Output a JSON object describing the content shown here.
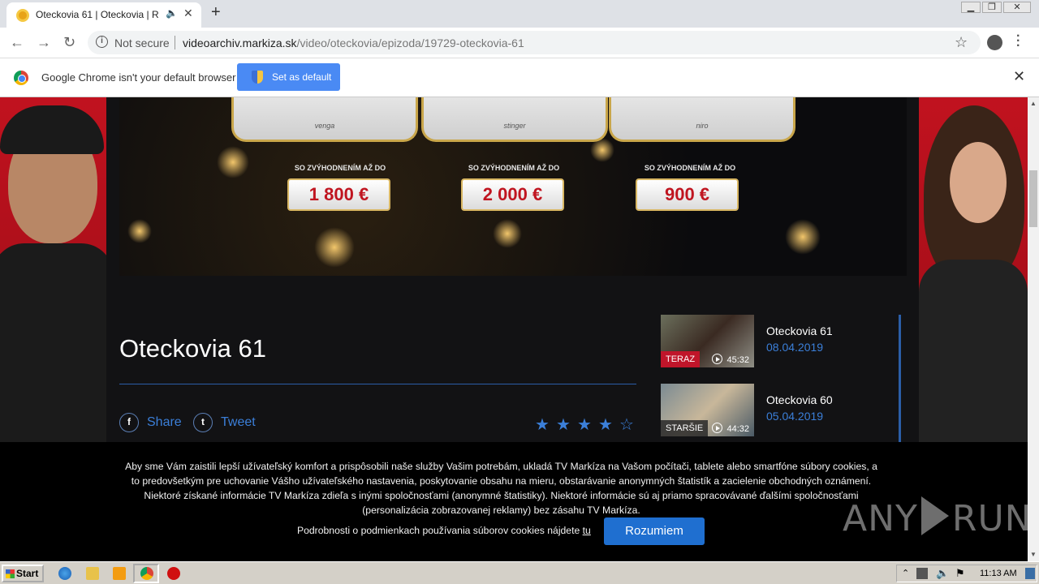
{
  "browser": {
    "tab_title": "Oteckovia 61 | Oteckovia | Relá",
    "url_security": "Not secure",
    "url_domain": "videoarchiv.markiza.sk",
    "url_path": "/video/oteckovia/epizoda/19729-oteckovia-61",
    "infobar_text": "Google Chrome isn't your default browser",
    "set_default_label": "Set as default"
  },
  "ad": {
    "cars": [
      "venga",
      "stinger",
      "niro"
    ],
    "caption": "SO ZVÝHODNENÍM AŽ DO",
    "prices": [
      "1 800 €",
      "2 000 €",
      "900 €"
    ]
  },
  "episode": {
    "title": "Oteckovia 61",
    "share_label": "Share",
    "tweet_label": "Tweet",
    "rating": 4,
    "rating_max": 5
  },
  "playlist": [
    {
      "badge": "TERAZ",
      "duration": "45:32",
      "title": "Oteckovia 61",
      "date": "08.04.2019"
    },
    {
      "badge": "STARŠIE",
      "duration": "44:32",
      "title": "Oteckovia 60",
      "date": "05.04.2019"
    }
  ],
  "cookie": {
    "text": "Aby sme Vám zaistili lepší užívateľský komfort a prispôsobili naše služby Vašim potrebám, ukladá TV Markíza na Vašom počítači, tablete alebo smartfóne súbory cookies, a to predovšetkým pre uchovanie Vášho užívateľského nastavenia, poskytovanie obsahu na mieru, obstarávanie anonymných štatistík a zacielenie obchodných oznámení. Niektoré získané informácie TV Markíza zdieľa s inými spoločnosťami (anonymné štatistiky). Niektoré informácie sú aj priamo spracovávané ďalšími spoločnosťami (personalizácia zobrazovanej reklamy) bez zásahu TV Markíza.",
    "more_text": "Podrobnosti o podmienkach používania súborov cookies nájdete",
    "more_link": "tu",
    "accept_label": "Rozumiem"
  },
  "watermark": {
    "left": "ANY",
    "right": "RUN"
  },
  "taskbar": {
    "start_label": "Start",
    "clock": "11:13 AM"
  }
}
